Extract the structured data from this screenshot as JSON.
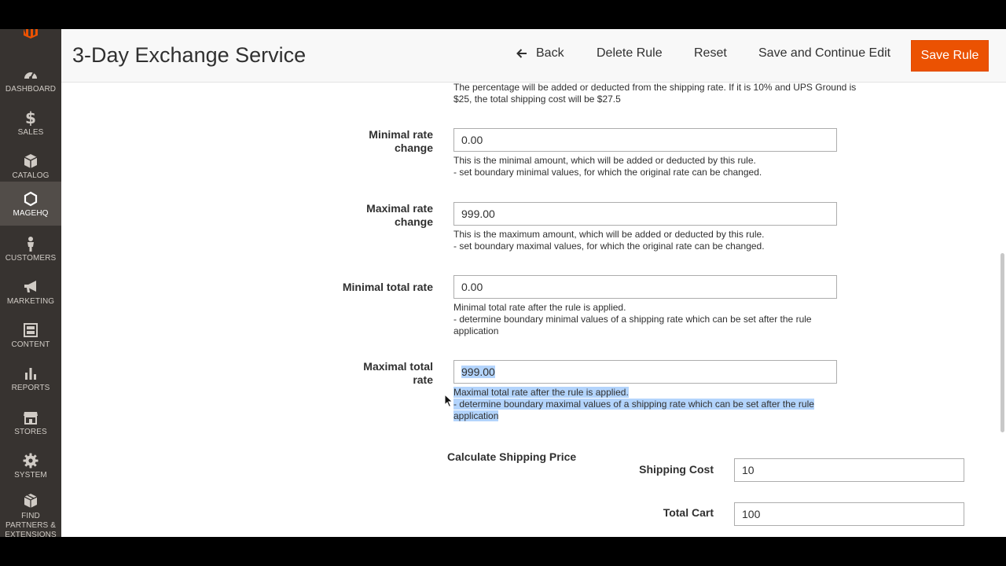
{
  "sidebar": {
    "items": [
      {
        "label": "DASHBOARD"
      },
      {
        "label": "SALES"
      },
      {
        "label": "CATALOG"
      },
      {
        "label": "MAGEHQ"
      },
      {
        "label": "CUSTOMERS"
      },
      {
        "label": "MARKETING"
      },
      {
        "label": "CONTENT"
      },
      {
        "label": "REPORTS"
      },
      {
        "label": "STORES"
      },
      {
        "label": "SYSTEM"
      },
      {
        "label": "FIND PARTNERS & EXTENSIONS"
      }
    ],
    "active": "MAGEHQ"
  },
  "header": {
    "title": "3-Day Exchange Service",
    "back_label": "Back",
    "delete_label": "Delete Rule",
    "reset_label": "Reset",
    "save_continue_label": "Save and Continue Edit",
    "save_label": "Save Rule"
  },
  "form": {
    "percent_note_1": "The percentage will be added or deducted from the shipping rate. If it is 10% and UPS Ground is",
    "percent_note_2": "$25, the total shipping cost will be $27.5",
    "min_rate_change": {
      "label_1": "Minimal rate",
      "label_2": "change",
      "value": "0.00",
      "note_1": "This is the minimal amount, which will be added or deducted by this rule.",
      "note_2": "- set boundary minimal values, for which the original rate can be changed."
    },
    "max_rate_change": {
      "label_1": "Maximal rate",
      "label_2": "change",
      "value": "999.00",
      "note_1": "This is the maximum amount, which will be added or deducted by this rule.",
      "note_2": "- set boundary maximal values, for which the original rate can be changed."
    },
    "min_total_rate": {
      "label": "Minimal total rate",
      "value": "0.00",
      "note_1": "Minimal total rate after the rule is applied.",
      "note_2": "- determine boundary minimal values of a shipping rate which can be set after the rule",
      "note_3": "application"
    },
    "max_total_rate": {
      "label_1": "Maximal total",
      "label_2": "rate",
      "value": "999.00",
      "note_1": "Maximal total rate after the rule is applied.",
      "note_2": "- determine boundary maximal values of a shipping rate which can be set after the rule",
      "note_3": "application"
    }
  },
  "calculator": {
    "title": "Calculate Shipping Price",
    "shipping_cost_label": "Shipping Cost",
    "shipping_cost_value": "10",
    "total_cart_label": "Total Cart",
    "total_cart_value": "100"
  },
  "colors": {
    "sidebar_bg": "#373330",
    "accent": "#eb5202",
    "selection": "#b3d4fc"
  }
}
